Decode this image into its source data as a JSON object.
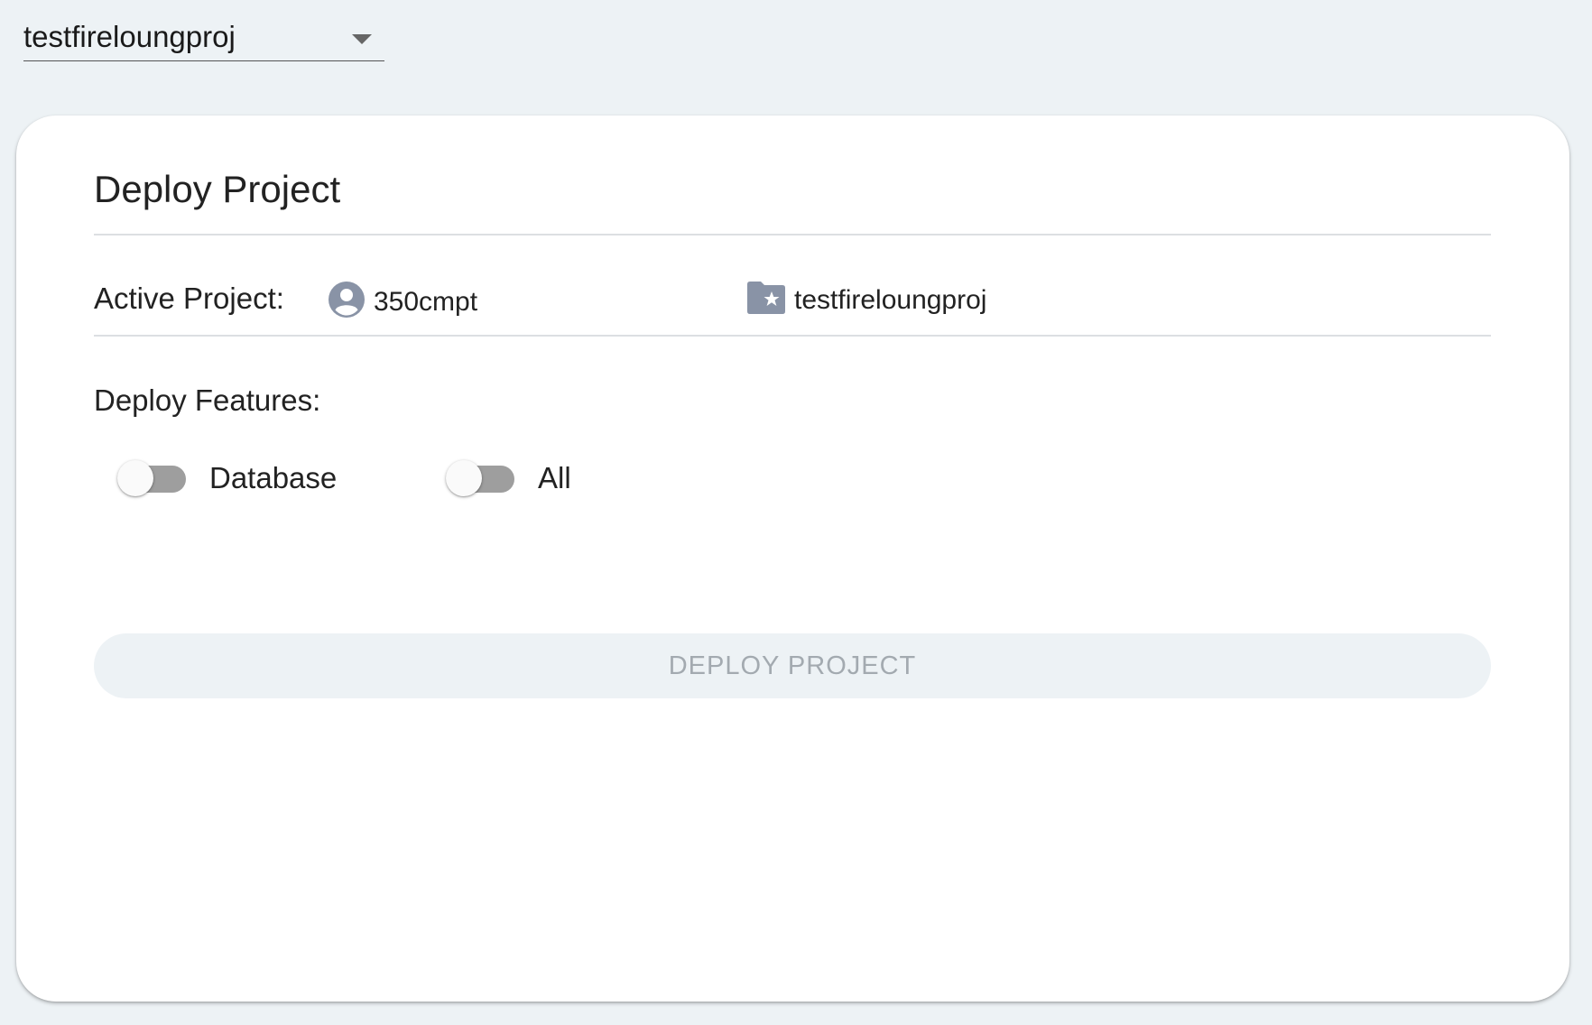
{
  "project_selector": {
    "value": "testfireloungproj"
  },
  "card": {
    "title": "Deploy Project",
    "active_project": {
      "label": "Active Project:",
      "account": {
        "icon": "account-circle-icon",
        "name": "350cmpt"
      },
      "project": {
        "icon": "folder-star-icon",
        "name": "testfireloungproj"
      }
    },
    "features": {
      "label": "Deploy Features:",
      "toggles": [
        {
          "label": "Database",
          "checked": false
        },
        {
          "label": "All",
          "checked": false
        }
      ]
    },
    "deploy_button": {
      "label": "DEPLOY PROJECT",
      "disabled": true
    }
  },
  "colors": {
    "background": "#edf2f5",
    "card": "#ffffff",
    "icon": "#8993a6",
    "toggle_track_off": "#9e9e9e",
    "button_disabled_bg": "#edf2f5",
    "button_disabled_text": "#a3aab0"
  }
}
